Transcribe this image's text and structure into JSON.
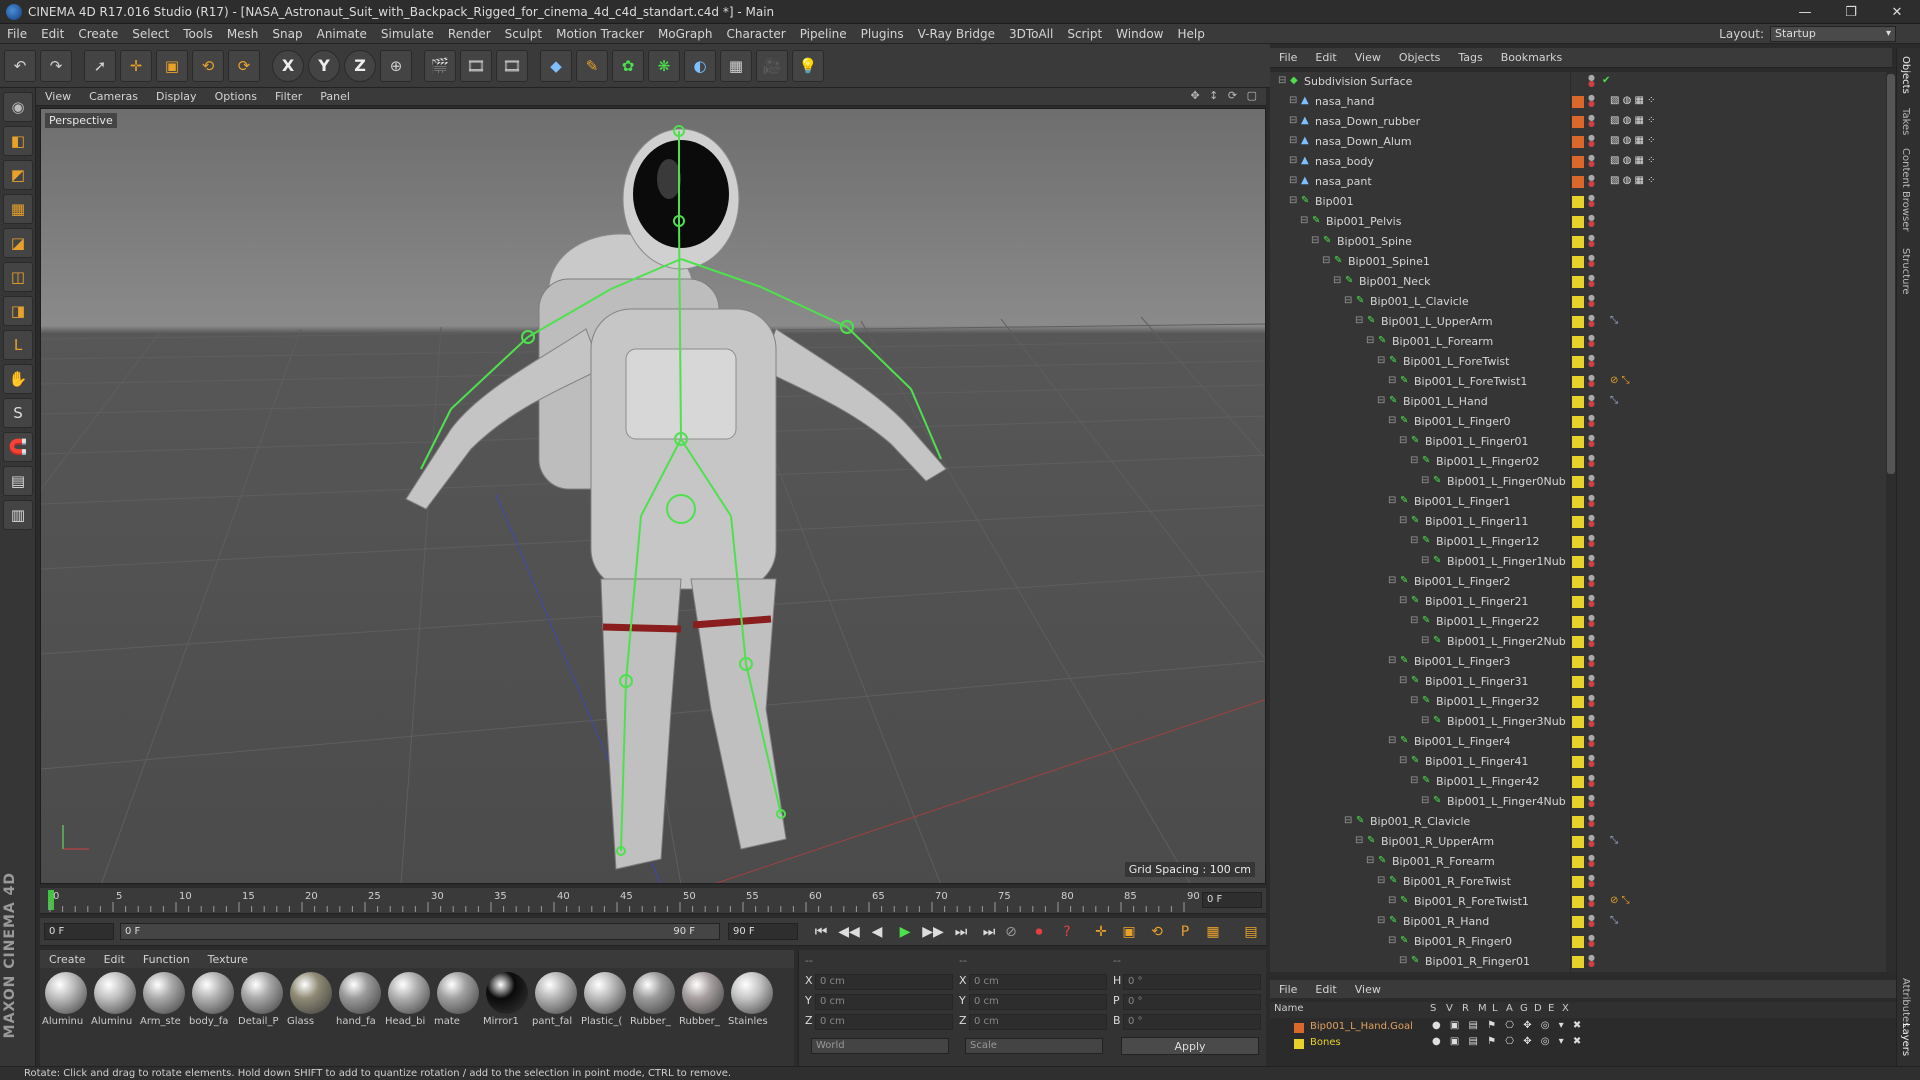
{
  "window": {
    "title": "CINEMA 4D R17.016 Studio (R17) - [NASA_Astronaut_Suit_with_Backpack_Rigged_for_cinema_4d_c4d_standart.c4d *] - Main",
    "controls": [
      "—",
      "❐",
      "✕"
    ]
  },
  "menu": [
    "File",
    "Edit",
    "Create",
    "Select",
    "Tools",
    "Mesh",
    "Snap",
    "Animate",
    "Simulate",
    "Render",
    "Sculpt",
    "Motion Tracker",
    "MoGraph",
    "Character",
    "Pipeline",
    "Plugins",
    "V-Ray Bridge",
    "3DToAll",
    "Script",
    "Window",
    "Help"
  ],
  "layout": {
    "label": "Layout:",
    "value": "Startup"
  },
  "toolbar": {
    "undo": "↶",
    "redo": "↷",
    "tools": [
      "➚",
      "✛",
      "▣",
      "⟲",
      "⟳"
    ],
    "axes": [
      "X",
      "Y",
      "Z"
    ],
    "coord": "⊕",
    "render": [
      "🎬",
      "🎞",
      "🎞"
    ],
    "create": [
      "◆",
      "✎",
      "✿",
      "❋",
      "◐",
      "▦",
      "🎥",
      "💡"
    ]
  },
  "left_tools": [
    "◉",
    "◧",
    "◩",
    "▦",
    "◪",
    "◫",
    "◨",
    "L",
    "✋",
    "S",
    "🧲",
    "▤",
    "▥"
  ],
  "branding": "MAXON CINEMA 4D",
  "viewport": {
    "menu": [
      "View",
      "Cameras",
      "Display",
      "Options",
      "Filter",
      "Panel"
    ],
    "nav_icons": "✥ ↕ ⟳ ▢",
    "camera_label": "Perspective",
    "grid_spacing": "Grid Spacing : 100 cm"
  },
  "timeline": {
    "ticks": [
      "0",
      "5",
      "10",
      "15",
      "20",
      "25",
      "30",
      "35",
      "40",
      "45",
      "50",
      "55",
      "60",
      "65",
      "70",
      "75",
      "80",
      "85",
      "90"
    ],
    "current_frame_display": "0 F",
    "start_field": "0 F",
    "range_start": "0 F",
    "range_end": "90 F",
    "end_field": "90 F"
  },
  "transport": {
    "buttons": [
      "⏮",
      "◀◀",
      "◀",
      "▶",
      "▶▶",
      "⏭",
      "⏭"
    ],
    "record": [
      "⊘",
      "⏺",
      "?"
    ],
    "key_tools": [
      "✛",
      "▣",
      "⟲",
      "P",
      "▦",
      "▤"
    ]
  },
  "materials": {
    "menu": [
      "Create",
      "Edit",
      "Function",
      "Texture"
    ],
    "items": [
      {
        "name": "Aluminu",
        "color": "#bdbdbd"
      },
      {
        "name": "Aluminu",
        "color": "#c2c2c2"
      },
      {
        "name": "Arm_ste",
        "color": "#aaaaaa"
      },
      {
        "name": "body_fa",
        "color": "#b3b3b3"
      },
      {
        "name": "Detail_P",
        "color": "#a8a8a8"
      },
      {
        "name": "Glass",
        "color": "#8f8a75"
      },
      {
        "name": "hand_fa",
        "color": "#9a9a9a"
      },
      {
        "name": "Head_bi",
        "color": "#b0b0b0"
      },
      {
        "name": "mate",
        "color": "#a0a0a0"
      },
      {
        "name": "Mirror1",
        "color": "#0a0a0a"
      },
      {
        "name": "pant_fal",
        "color": "#b5b5b5"
      },
      {
        "name": "Plastic_(",
        "color": "#bcbcbc"
      },
      {
        "name": "Rubber_",
        "color": "#9c9c9c"
      },
      {
        "name": "Rubber_",
        "color": "#a8a0a0"
      },
      {
        "name": "Stainles",
        "color": "#c6c6c6"
      }
    ]
  },
  "coords": {
    "header": [
      "--",
      "--",
      "--"
    ],
    "rows": [
      {
        "a1": "X",
        "v1": "0 cm",
        "a2": "X",
        "v2": "0 cm",
        "a3": "H",
        "v3": "0 °"
      },
      {
        "a1": "Y",
        "v1": "0 cm",
        "a2": "Y",
        "v2": "0 cm",
        "a3": "P",
        "v3": "0 °"
      },
      {
        "a1": "Z",
        "v1": "0 cm",
        "a2": "Z",
        "v2": "0 cm",
        "a3": "B",
        "v3": "0 °"
      }
    ],
    "space": "World",
    "mode": "Scale",
    "apply": "Apply"
  },
  "status": "Rotate: Click and drag to rotate elements. Hold down SHIFT to add to quantize rotation / add to the selection in point mode, CTRL to remove.",
  "object_manager": {
    "menu": [
      "File",
      "Edit",
      "View",
      "Objects",
      "Tags",
      "Bookmarks"
    ],
    "objects": [
      {
        "name": "Subdivision Surface",
        "depth": 0,
        "kind": "subd",
        "tag": "",
        "mat": false,
        "check": true
      },
      {
        "name": "nasa_hand",
        "depth": 1,
        "kind": "poly",
        "tag": "#d9682a",
        "mat": true
      },
      {
        "name": "nasa_Down_rubber",
        "depth": 1,
        "kind": "poly",
        "tag": "#d9682a",
        "mat": true
      },
      {
        "name": "nasa_Down_Alum",
        "depth": 1,
        "kind": "poly",
        "tag": "#d9682a",
        "mat": true
      },
      {
        "name": "nasa_body",
        "depth": 1,
        "kind": "poly",
        "tag": "#d9682a",
        "mat": true
      },
      {
        "name": "nasa_pant",
        "depth": 1,
        "kind": "poly",
        "tag": "#d9682a",
        "mat": true
      },
      {
        "name": "Bip001",
        "depth": 1,
        "kind": "bone",
        "tag": "#e6d22a"
      },
      {
        "name": "Bip001_Pelvis",
        "depth": 2,
        "kind": "bone",
        "tag": "#e6d22a"
      },
      {
        "name": "Bip001_Spine",
        "depth": 3,
        "kind": "bone",
        "tag": "#e6d22a"
      },
      {
        "name": "Bip001_Spine1",
        "depth": 4,
        "kind": "bone",
        "tag": "#e6d22a"
      },
      {
        "name": "Bip001_Neck",
        "depth": 5,
        "kind": "bone",
        "tag": "#e6d22a"
      },
      {
        "name": "Bip001_L_Clavicle",
        "depth": 6,
        "kind": "bone",
        "tag": "#e6d22a"
      },
      {
        "name": "Bip001_L_UpperArm",
        "depth": 7,
        "kind": "bone",
        "tag": "#e6d22a",
        "extra": "ik"
      },
      {
        "name": "Bip001_L_Forearm",
        "depth": 8,
        "kind": "bone",
        "tag": "#e6d22a"
      },
      {
        "name": "Bip001_L_ForeTwist",
        "depth": 9,
        "kind": "bone",
        "tag": "#e6d22a"
      },
      {
        "name": "Bip001_L_ForeTwist1",
        "depth": 10,
        "kind": "bone",
        "tag": "#e6d22a",
        "extra": "constraint"
      },
      {
        "name": "Bip001_L_Hand",
        "depth": 9,
        "kind": "bone",
        "tag": "#e6d22a",
        "extra": "ik"
      },
      {
        "name": "Bip001_L_Finger0",
        "depth": 10,
        "kind": "bone",
        "tag": "#e6d22a"
      },
      {
        "name": "Bip001_L_Finger01",
        "depth": 11,
        "kind": "bone",
        "tag": "#e6d22a"
      },
      {
        "name": "Bip001_L_Finger02",
        "depth": 12,
        "kind": "bone",
        "tag": "#e6d22a"
      },
      {
        "name": "Bip001_L_Finger0Nub",
        "depth": 13,
        "kind": "bone",
        "tag": "#e6d22a"
      },
      {
        "name": "Bip001_L_Finger1",
        "depth": 10,
        "kind": "bone",
        "tag": "#e6d22a"
      },
      {
        "name": "Bip001_L_Finger11",
        "depth": 11,
        "kind": "bone",
        "tag": "#e6d22a"
      },
      {
        "name": "Bip001_L_Finger12",
        "depth": 12,
        "kind": "bone",
        "tag": "#e6d22a"
      },
      {
        "name": "Bip001_L_Finger1Nub",
        "depth": 13,
        "kind": "bone",
        "tag": "#e6d22a"
      },
      {
        "name": "Bip001_L_Finger2",
        "depth": 10,
        "kind": "bone",
        "tag": "#e6d22a"
      },
      {
        "name": "Bip001_L_Finger21",
        "depth": 11,
        "kind": "bone",
        "tag": "#e6d22a"
      },
      {
        "name": "Bip001_L_Finger22",
        "depth": 12,
        "kind": "bone",
        "tag": "#e6d22a"
      },
      {
        "name": "Bip001_L_Finger2Nub",
        "depth": 13,
        "kind": "bone",
        "tag": "#e6d22a"
      },
      {
        "name": "Bip001_L_Finger3",
        "depth": 10,
        "kind": "bone",
        "tag": "#e6d22a"
      },
      {
        "name": "Bip001_L_Finger31",
        "depth": 11,
        "kind": "bone",
        "tag": "#e6d22a"
      },
      {
        "name": "Bip001_L_Finger32",
        "depth": 12,
        "kind": "bone",
        "tag": "#e6d22a"
      },
      {
        "name": "Bip001_L_Finger3Nub",
        "depth": 13,
        "kind": "bone",
        "tag": "#e6d22a"
      },
      {
        "name": "Bip001_L_Finger4",
        "depth": 10,
        "kind": "bone",
        "tag": "#e6d22a"
      },
      {
        "name": "Bip001_L_Finger41",
        "depth": 11,
        "kind": "bone",
        "tag": "#e6d22a"
      },
      {
        "name": "Bip001_L_Finger42",
        "depth": 12,
        "kind": "bone",
        "tag": "#e6d22a"
      },
      {
        "name": "Bip001_L_Finger4Nub",
        "depth": 13,
        "kind": "bone",
        "tag": "#e6d22a"
      },
      {
        "name": "Bip001_R_Clavicle",
        "depth": 6,
        "kind": "bone",
        "tag": "#e6d22a"
      },
      {
        "name": "Bip001_R_UpperArm",
        "depth": 7,
        "kind": "bone",
        "tag": "#e6d22a",
        "extra": "ik"
      },
      {
        "name": "Bip001_R_Forearm",
        "depth": 8,
        "kind": "bone",
        "tag": "#e6d22a"
      },
      {
        "name": "Bip001_R_ForeTwist",
        "depth": 9,
        "kind": "bone",
        "tag": "#e6d22a"
      },
      {
        "name": "Bip001_R_ForeTwist1",
        "depth": 10,
        "kind": "bone",
        "tag": "#e6d22a",
        "extra": "constraint"
      },
      {
        "name": "Bip001_R_Hand",
        "depth": 9,
        "kind": "bone",
        "tag": "#e6d22a",
        "extra": "ik"
      },
      {
        "name": "Bip001_R_Finger0",
        "depth": 10,
        "kind": "bone",
        "tag": "#e6d22a"
      },
      {
        "name": "Bip001_R_Finger01",
        "depth": 11,
        "kind": "bone",
        "tag": "#e6d22a"
      }
    ]
  },
  "layer_manager": {
    "menu": [
      "File",
      "Edit",
      "View"
    ],
    "columns": [
      "Name",
      "S",
      "V",
      "R",
      "M",
      "L",
      "A",
      "G",
      "D",
      "E",
      "X"
    ],
    "layers": [
      {
        "name": "Bip001_L_Hand.Goal",
        "color": "#d9682a",
        "text_color": "#e0a060"
      },
      {
        "name": "Bones",
        "color": "#e6d22a",
        "text_color": "#e6d22a"
      }
    ],
    "flags": "● ▣ ▤ ⚑ ⎔ ✥ ◎ ▾ ✖"
  },
  "right_tabs": [
    "Objects",
    "Takes",
    "Content Browser",
    "Structure",
    "Attributes",
    "Layers"
  ]
}
